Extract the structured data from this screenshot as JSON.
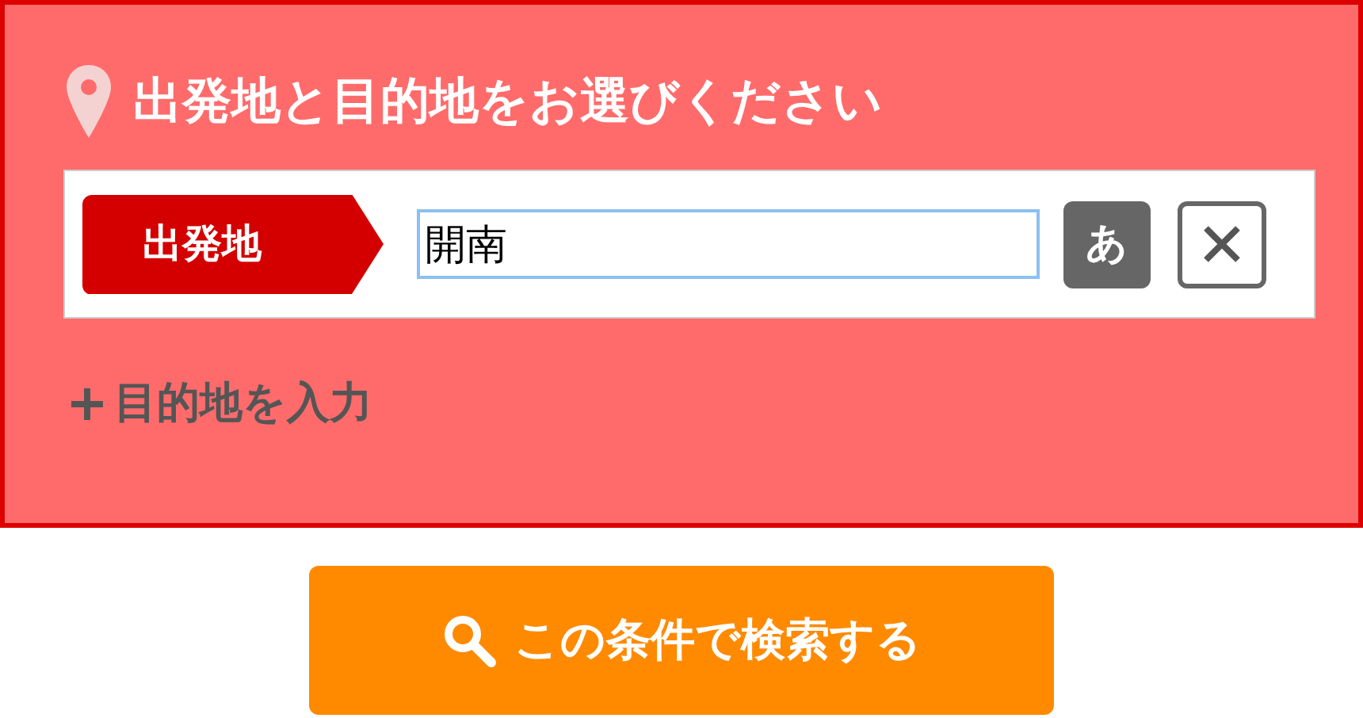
{
  "panel": {
    "title": "出発地と目的地をお選びください"
  },
  "origin": {
    "label": "出発地",
    "value": "開南",
    "kana_button": "あ"
  },
  "add_destination": {
    "label": "目的地を入力"
  },
  "search_button": {
    "label": "この条件で検索する"
  }
}
